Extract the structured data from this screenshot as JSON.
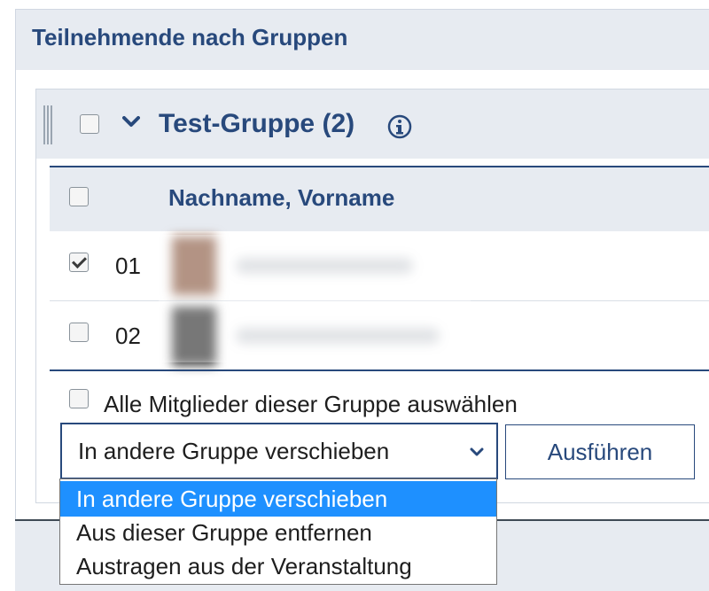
{
  "section": {
    "title": "Teilnehmende nach Gruppen"
  },
  "group": {
    "title": "Test-Gruppe (2)",
    "icons": {
      "drag": "drag-handle-icon",
      "toggle": "chevron-down-icon",
      "info": "info-icon"
    }
  },
  "table": {
    "column_header": "Nachname, Vorname",
    "rows": [
      {
        "number": "01",
        "checked": true
      },
      {
        "number": "02",
        "checked": false
      }
    ]
  },
  "select_all_label": "Alle Mitglieder dieser Gruppe auswählen",
  "action_select": {
    "value": "In andere Gruppe verschieben",
    "options": [
      "In andere Gruppe verschieben",
      "Aus dieser Gruppe entfernen",
      "Austragen aus der Veranstaltung"
    ],
    "selected_index": 0
  },
  "execute_button": "Ausführen",
  "colors": {
    "primary": "#28497c",
    "header_bg": "#e7ebf1",
    "option_highlight": "#1e90ff"
  }
}
